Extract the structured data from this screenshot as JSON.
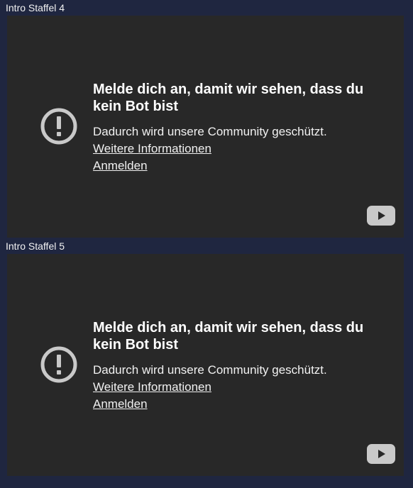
{
  "videos": [
    {
      "section_title": "Intro Staffel 4",
      "title": "Melde dich an, damit wir sehen, dass du kein Bot bist",
      "subtitle": "Dadurch wird unsere Community geschützt.",
      "link_more": "Weitere Informationen",
      "link_signin": "Anmelden",
      "warning_icon": "exclamation-circle-icon",
      "play_icon": "youtube-play-icon"
    },
    {
      "section_title": "Intro Staffel 5",
      "title": "Melde dich an, damit wir sehen, dass du kein Bot bist",
      "subtitle": "Dadurch wird unsere Community geschützt.",
      "link_more": "Weitere Informationen",
      "link_signin": "Anmelden",
      "warning_icon": "exclamation-circle-icon",
      "play_icon": "youtube-play-icon"
    }
  ],
  "colors": {
    "page_background": "#1f2640",
    "player_background": "#282828",
    "icon_gray": "#c9c9c9"
  }
}
